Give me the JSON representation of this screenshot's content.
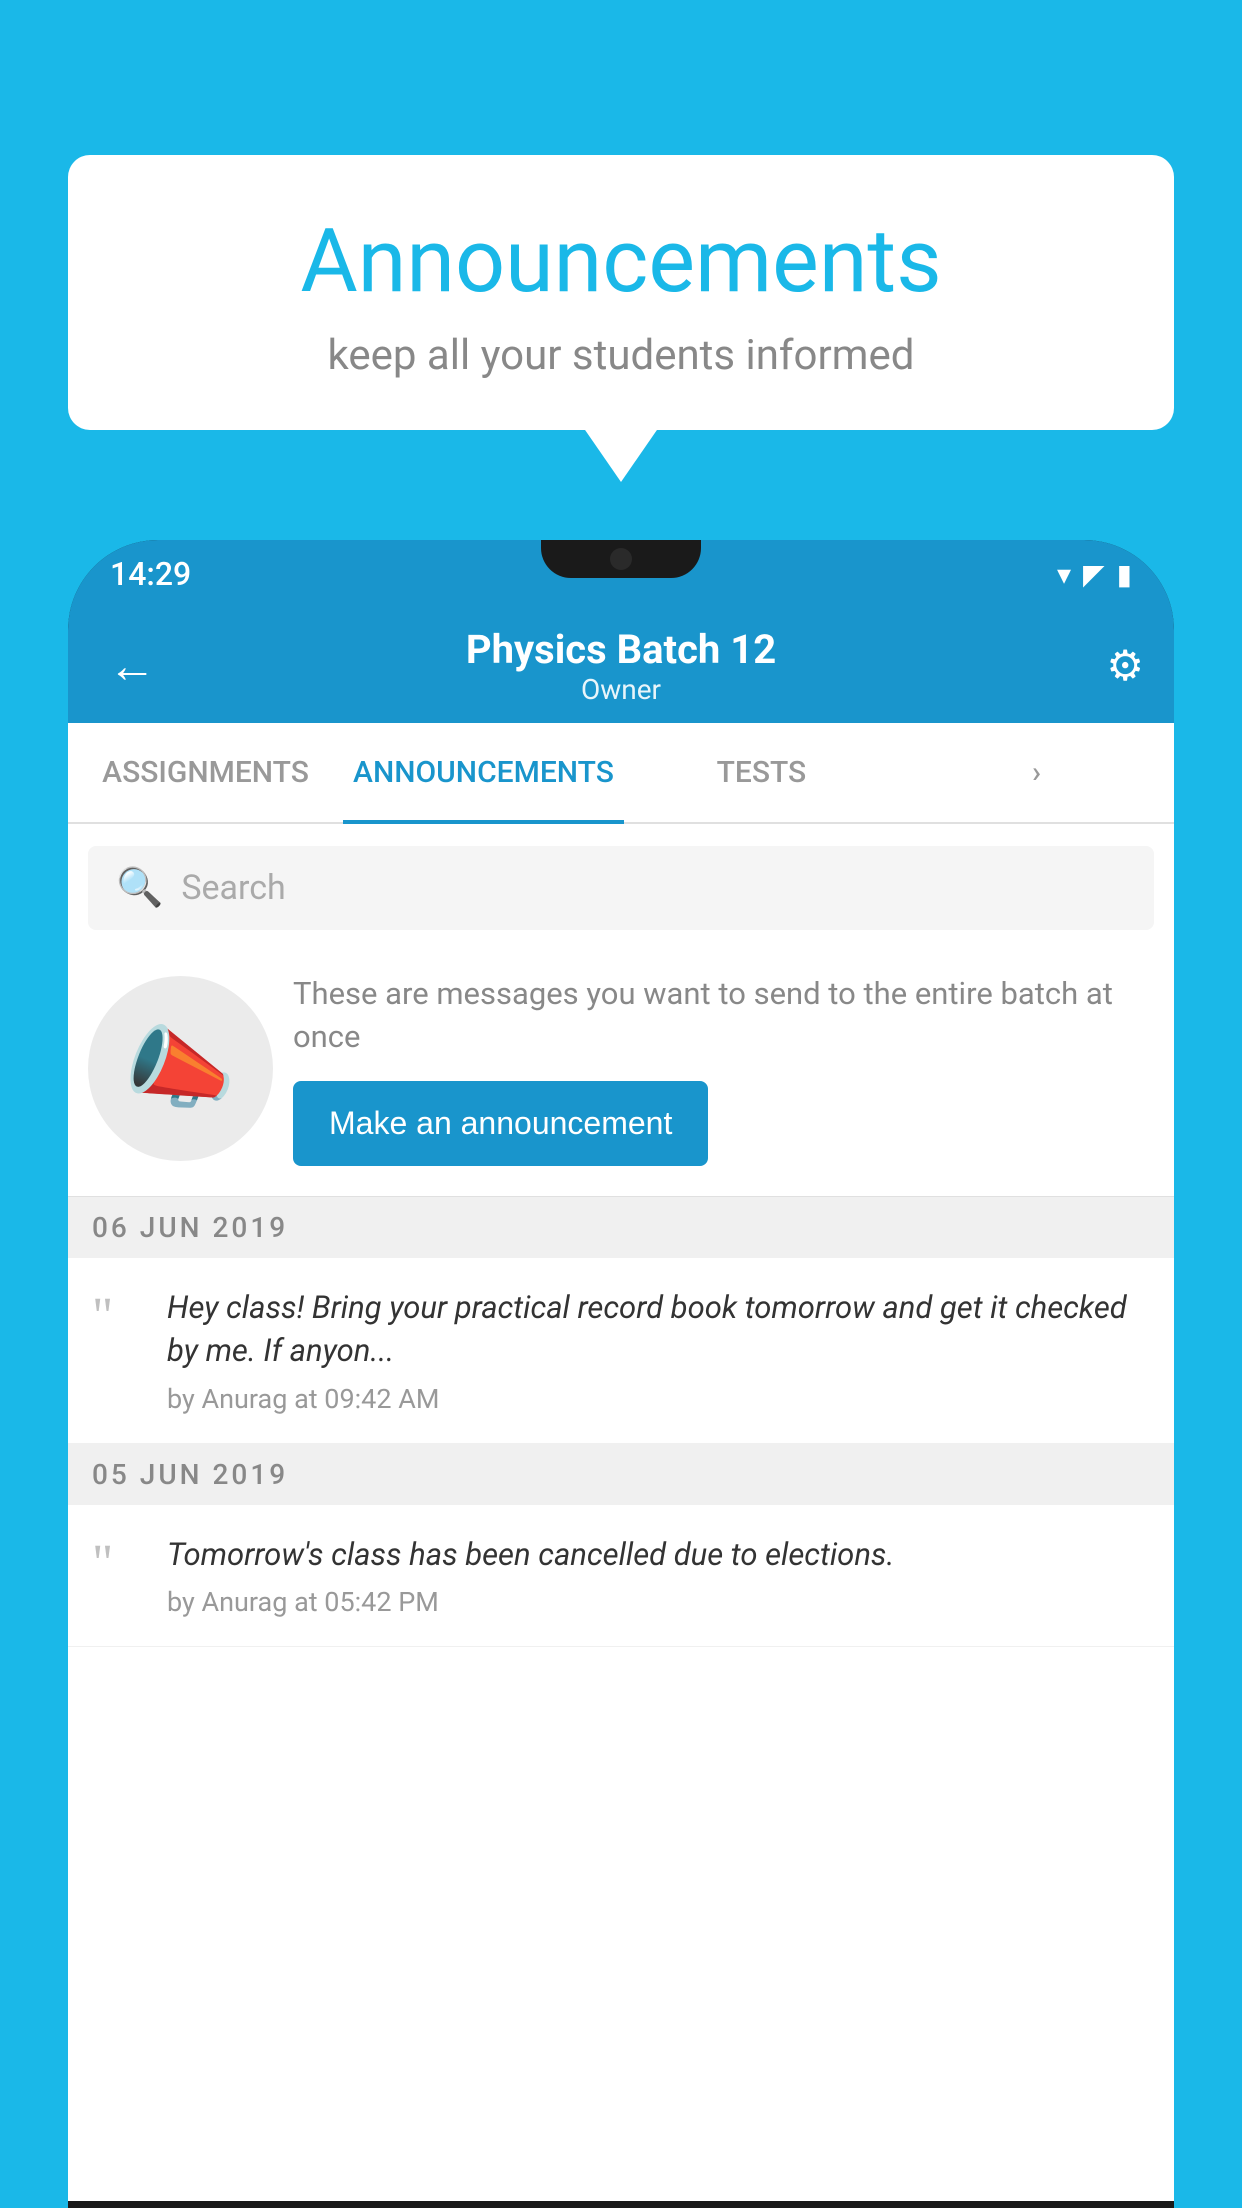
{
  "bubble": {
    "title": "Announcements",
    "subtitle": "keep all your students informed"
  },
  "statusBar": {
    "time": "14:29",
    "icons": "▼◀▮"
  },
  "header": {
    "title": "Physics Batch 12",
    "subtitle": "Owner",
    "backLabel": "←",
    "settingsLabel": "⚙"
  },
  "tabs": [
    {
      "label": "ASSIGNMENTS",
      "active": false
    },
    {
      "label": "ANNOUNCEMENTS",
      "active": true
    },
    {
      "label": "TESTS",
      "active": false
    },
    {
      "label": "›",
      "active": false
    }
  ],
  "search": {
    "placeholder": "Search"
  },
  "promo": {
    "text": "These are messages you want to send to the entire batch at once",
    "buttonLabel": "Make an announcement"
  },
  "announcements": [
    {
      "date": "06  JUN  2019",
      "text": "Hey class! Bring your practical record book tomorrow and get it checked by me. If anyon...",
      "meta": "by Anurag at 09:42 AM"
    },
    {
      "date": "05  JUN  2019",
      "text": "Tomorrow's class has been cancelled due to elections.",
      "meta": "by Anurag at 05:42 PM"
    }
  ],
  "colors": {
    "primary": "#1995cc",
    "background": "#1ab8e8",
    "white": "#ffffff"
  }
}
